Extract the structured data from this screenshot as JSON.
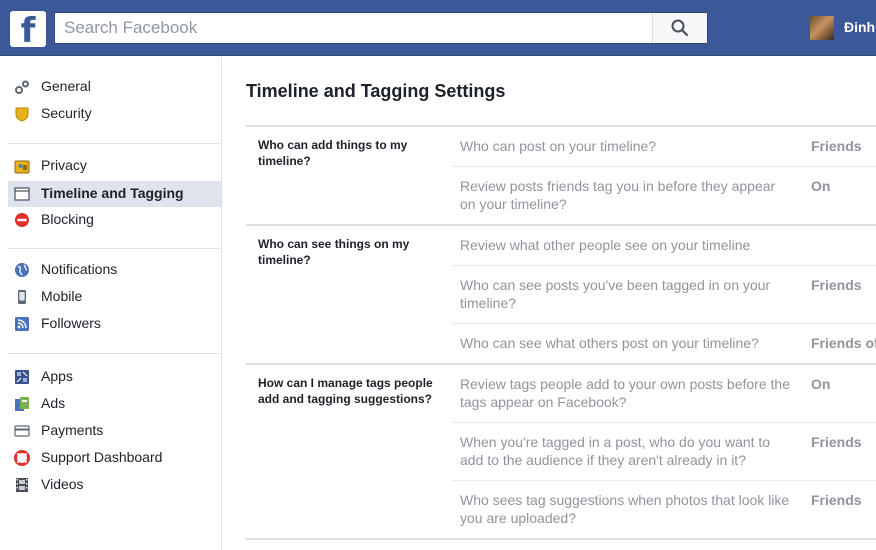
{
  "header": {
    "logo_letter": "f",
    "search_placeholder": "Search Facebook",
    "user_name": "Đinh",
    "brand_color": "#3b5998"
  },
  "sidebar": {
    "groups": [
      {
        "items": [
          {
            "label": "General",
            "icon": "gears-icon"
          },
          {
            "label": "Security",
            "icon": "shield-icon"
          }
        ]
      },
      {
        "items": [
          {
            "label": "Privacy",
            "icon": "lock-icon"
          },
          {
            "label": "Timeline and Tagging",
            "icon": "timeline-icon",
            "selected": true
          },
          {
            "label": "Blocking",
            "icon": "block-icon"
          }
        ]
      },
      {
        "items": [
          {
            "label": "Notifications",
            "icon": "globe-icon"
          },
          {
            "label": "Mobile",
            "icon": "mobile-icon"
          },
          {
            "label": "Followers",
            "icon": "rss-icon"
          }
        ]
      },
      {
        "items": [
          {
            "label": "Apps",
            "icon": "apps-icon"
          },
          {
            "label": "Ads",
            "icon": "ads-icon"
          },
          {
            "label": "Payments",
            "icon": "credit-card-icon"
          },
          {
            "label": "Support Dashboard",
            "icon": "lifebuoy-icon"
          },
          {
            "label": "Videos",
            "icon": "film-icon"
          }
        ]
      }
    ]
  },
  "main": {
    "title": "Timeline and Tagging Settings",
    "sections": [
      {
        "title": "Who can add things to my timeline?",
        "rows": [
          {
            "question": "Who can post on your timeline?",
            "value": "Friends"
          },
          {
            "question": "Review posts friends tag you in before they appear on your timeline?",
            "value": "On"
          }
        ]
      },
      {
        "title": "Who can see things on my timeline?",
        "rows": [
          {
            "question": "Review what other people see on your timeline",
            "value": ""
          },
          {
            "question": "Who can see posts you've been tagged in on your timeline?",
            "value": "Friends"
          },
          {
            "question": "Who can see what others post on your timeline?",
            "value": "Friends of"
          }
        ]
      },
      {
        "title": "How can I manage tags people add and tagging suggestions?",
        "rows": [
          {
            "question": "Review tags people add to your own posts before the tags appear on Facebook?",
            "value": "On"
          },
          {
            "question": "When you're tagged in a post, who do you want to add to the audience if they aren't already in it?",
            "value": "Friends"
          },
          {
            "question": "Who sees tag suggestions when photos that look like you are uploaded?",
            "value": "Friends"
          }
        ]
      }
    ]
  }
}
